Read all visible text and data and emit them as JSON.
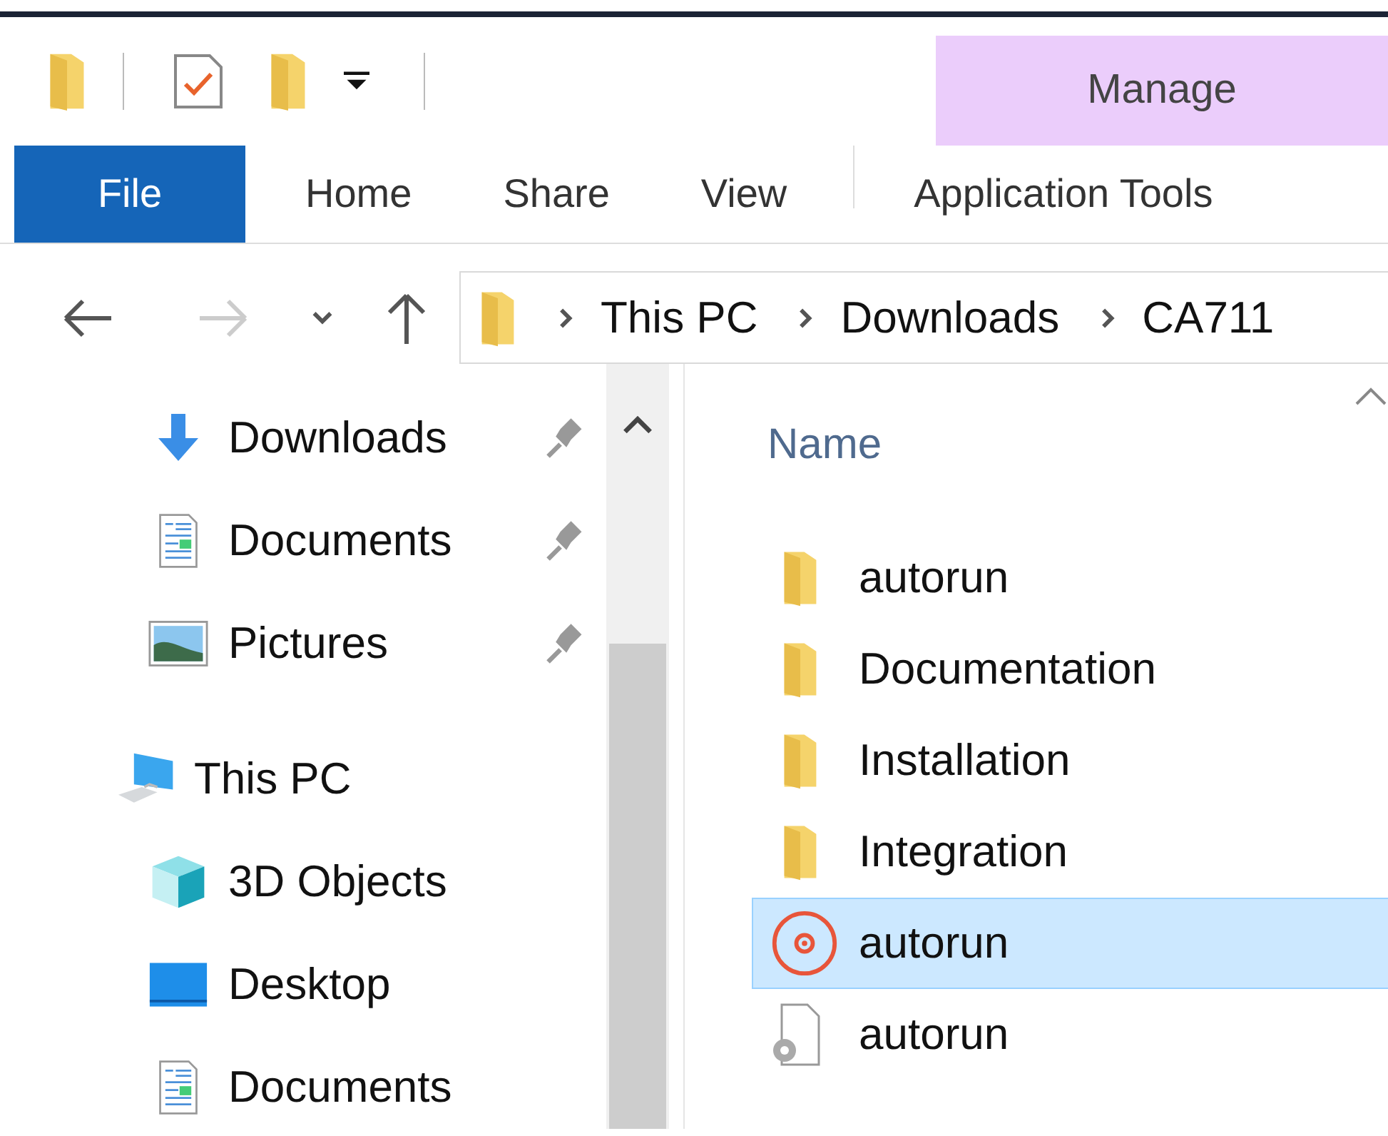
{
  "contextual_tab": {
    "label": "Manage"
  },
  "tabs": [
    {
      "label": "File",
      "kind": "file"
    },
    {
      "label": "Home",
      "kind": "tab"
    },
    {
      "label": "Share",
      "kind": "tab"
    },
    {
      "label": "View",
      "kind": "tab"
    },
    {
      "label": "Application Tools",
      "kind": "contextual"
    }
  ],
  "address_bar": {
    "path": [
      "This PC",
      "Downloads",
      "CA711"
    ]
  },
  "navigation_pane": {
    "items": [
      {
        "label": "Downloads",
        "kind": "download",
        "pinned": true
      },
      {
        "label": "Documents",
        "kind": "document",
        "pinned": true
      },
      {
        "label": "Pictures",
        "kind": "pictures",
        "pinned": true
      },
      {
        "label": "This PC",
        "kind": "pc",
        "children": [
          {
            "label": "3D Objects",
            "kind": "cube"
          },
          {
            "label": "Desktop",
            "kind": "desktop"
          },
          {
            "label": "Documents",
            "kind": "document"
          }
        ]
      }
    ]
  },
  "file_list": {
    "columns": [
      "Name"
    ],
    "rows": [
      {
        "name": "autorun",
        "kind": "folder",
        "selected": false
      },
      {
        "name": "Documentation",
        "kind": "folder",
        "selected": false
      },
      {
        "name": "Installation",
        "kind": "folder",
        "selected": false
      },
      {
        "name": "Integration",
        "kind": "folder",
        "selected": false
      },
      {
        "name": "autorun",
        "kind": "disc",
        "selected": true
      },
      {
        "name": "autorun",
        "kind": "settings-file",
        "selected": false
      }
    ]
  }
}
